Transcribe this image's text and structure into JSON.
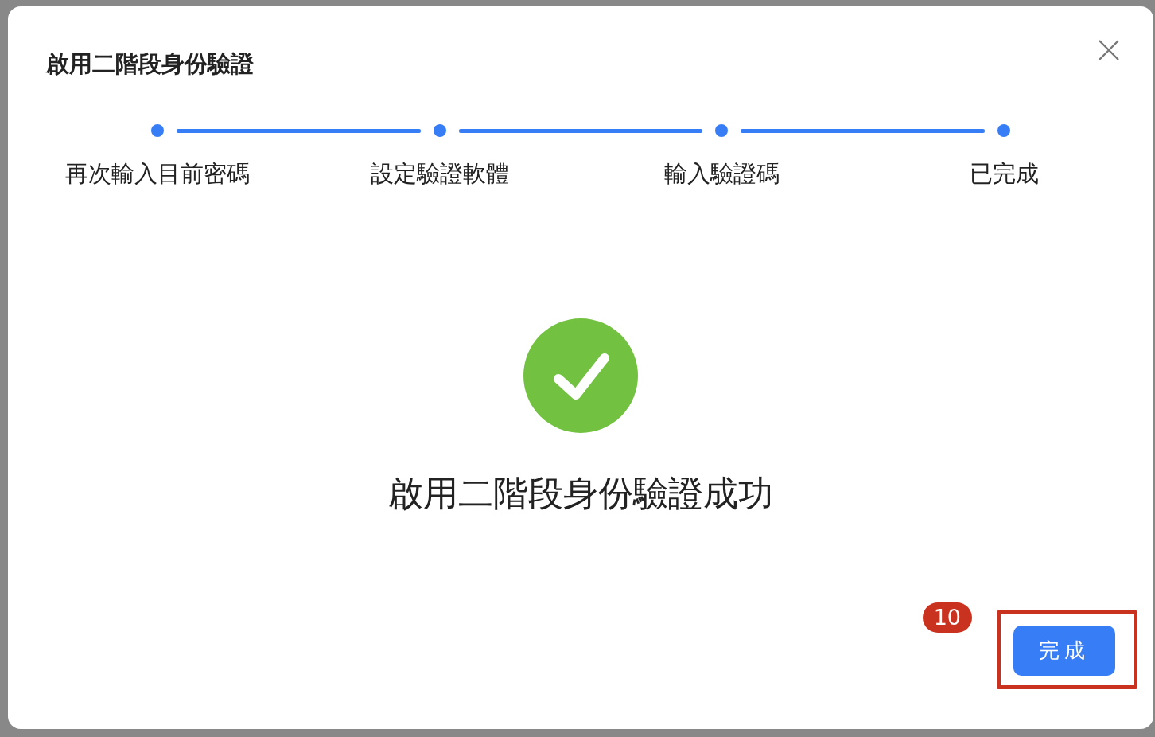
{
  "dialog": {
    "title": "啟用二階段身份驗證",
    "steps": [
      {
        "label": "再次輸入目前密碼",
        "done": true
      },
      {
        "label": "設定驗證軟體",
        "done": true
      },
      {
        "label": "輸入驗證碼",
        "done": true
      },
      {
        "label": "已完成",
        "done": true
      }
    ],
    "result": {
      "kind": "success",
      "message": "啟用二階段身份驗證成功"
    },
    "buttons": [
      {
        "label": "完成",
        "highlighted": true
      }
    ]
  },
  "annotation": {
    "badge": "10"
  }
}
